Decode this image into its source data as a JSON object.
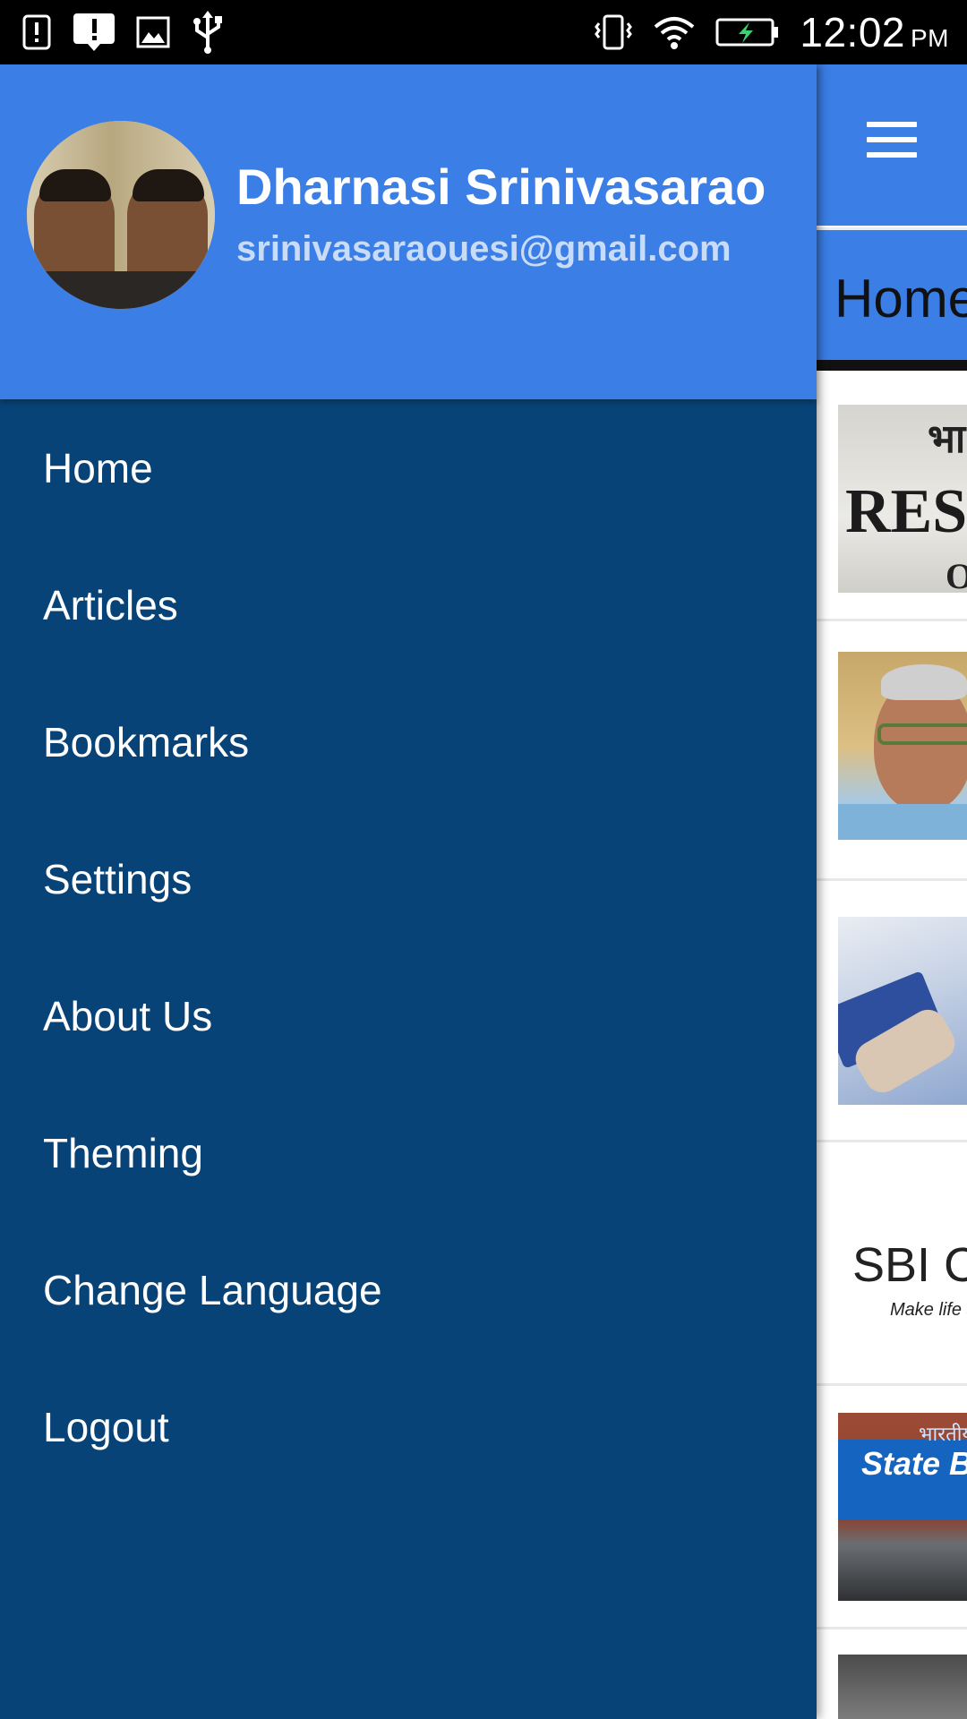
{
  "status_bar": {
    "time": "12:02",
    "ampm": "PM",
    "left_icons": [
      "alert-outline-icon",
      "alert-message-icon",
      "image-icon",
      "usb-icon"
    ],
    "right_icons": [
      "vibrate-icon",
      "wifi-icon",
      "battery-charging-icon"
    ]
  },
  "drawer": {
    "user": {
      "name": "Dharnasi Srinivasarao",
      "email": "srinivasaraouesi@gmail.com"
    },
    "menu": [
      {
        "label": "Home"
      },
      {
        "label": "Articles"
      },
      {
        "label": "Bookmarks"
      },
      {
        "label": "Settings"
      },
      {
        "label": "About Us"
      },
      {
        "label": "Theming"
      },
      {
        "label": "Change Language"
      },
      {
        "label": "Logout"
      }
    ]
  },
  "background_app": {
    "tab_home": "Home",
    "thumbnails": {
      "rbi_top": "भा",
      "rbi_text": "RESE",
      "rbi_bottom": "O",
      "sbi_card_logo": "SBI Car",
      "sbi_card_tagline": "Make life si",
      "sbi_hindi": "भारतीय",
      "sbi_sign": "State Ban"
    }
  },
  "colors": {
    "header_blue": "#3a7ee6",
    "drawer_navy": "#084378",
    "email_light_blue": "#c8dbf7"
  }
}
